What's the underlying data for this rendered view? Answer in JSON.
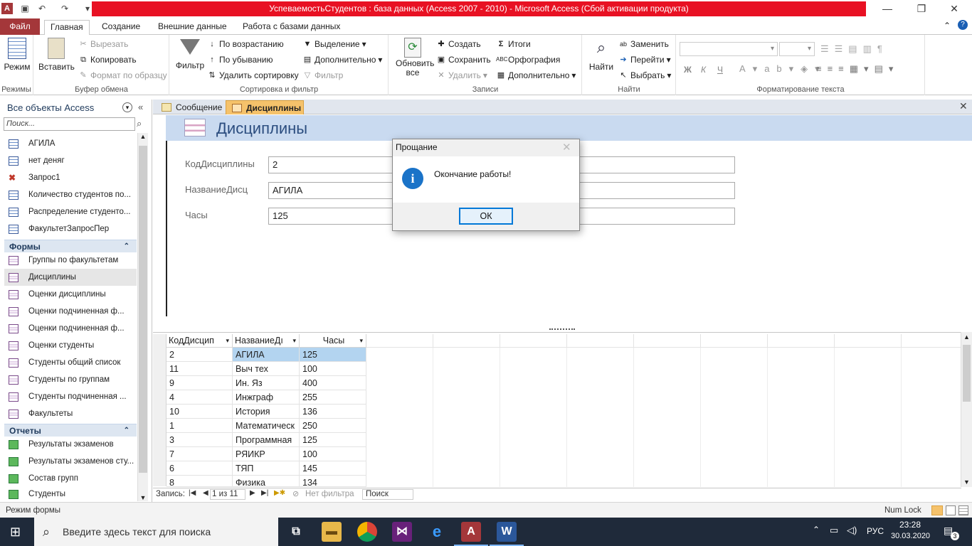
{
  "window": {
    "title": "УспеваемостьСтудентов : база данных (Access 2007 - 2010)  -  Microsoft Access (Сбой активации продукта)",
    "minimize": "—",
    "maximize": "❐",
    "close": "✕"
  },
  "ribbon_tabs": [
    "Файл",
    "Главная",
    "Создание",
    "Внешние данные",
    "Работа с базами данных"
  ],
  "ribbon": {
    "modes": {
      "view_label": "Режим",
      "group": "Режимы"
    },
    "clipboard": {
      "paste": "Вставить",
      "cut": "Вырезать",
      "copy": "Копировать",
      "format_painter": "Формат по образцу",
      "group": "Буфер обмена"
    },
    "sort_filter": {
      "filter": "Фильтр",
      "ascending": "По возрастанию",
      "descending": "По убыванию",
      "remove_sort": "Удалить сортировку",
      "selection": "Выделение",
      "advanced": "Дополнительно",
      "toggle_filter": "Фильтр",
      "group": "Сортировка и фильтр"
    },
    "records": {
      "refresh": "Обновить все",
      "new": "Создать",
      "save": "Сохранить",
      "delete": "Удалить",
      "totals": "Итоги",
      "spelling": "Орфография",
      "more": "Дополнительно",
      "group": "Записи"
    },
    "find": {
      "find": "Найти",
      "replace": "Заменить",
      "goto": "Перейти",
      "select": "Выбрать",
      "group": "Найти"
    },
    "text_format": {
      "bold": "Ж",
      "italic": "К",
      "underline": "Ч",
      "group": "Форматирование текста"
    }
  },
  "nav_pane": {
    "header": "Все объекты Access",
    "search_placeholder": "Поиск...",
    "queries": [
      "АГИЛА",
      "нет деняг",
      "Запрос1",
      "Количество студентов по...",
      "Распределение студенто...",
      "ФакультетЗапросПер"
    ],
    "forms_header": "Формы",
    "forms": [
      "Группы по факультетам",
      "Дисциплины",
      "Оценки дисциплины",
      "Оценки подчиненная ф...",
      "Оценки подчиненная ф...",
      "Оценки студенты",
      "Студенты общий список",
      "Студенты по группам",
      "Студенты подчиненная ...",
      "Факультеты"
    ],
    "reports_header": "Отчеты",
    "reports": [
      "Результаты экзаменов",
      "Результаты экзаменов сту...",
      "Состав групп",
      "Студенты"
    ]
  },
  "doc_tabs": [
    "Сообщение",
    "Дисциплины"
  ],
  "form": {
    "title": "Дисциплины",
    "fields": [
      {
        "label": "КодДисциплины",
        "value": "2"
      },
      {
        "label": "НазваниеДисц",
        "value": "АГИЛА"
      },
      {
        "label": "Часы",
        "value": "125"
      }
    ]
  },
  "datasheet": {
    "columns": [
      "КодДисцип",
      "НазваниеДı",
      "Часы"
    ],
    "rows": [
      [
        "2",
        "АГИЛА",
        "125"
      ],
      [
        "11",
        "Выч тех",
        "100"
      ],
      [
        "9",
        "Ин. Яз",
        "400"
      ],
      [
        "4",
        "Инжграф",
        "255"
      ],
      [
        "10",
        "История",
        "136"
      ],
      [
        "1",
        "Математическ",
        "250"
      ],
      [
        "3",
        "Программная",
        "125"
      ],
      [
        "7",
        "РЯИКР",
        "100"
      ],
      [
        "6",
        "ТЯП",
        "145"
      ],
      [
        "8",
        "Физика",
        "134"
      ]
    ]
  },
  "record_nav": {
    "label": "Запись:",
    "position": "1 из 11",
    "filter": "Нет фильтра",
    "search": "Поиск"
  },
  "status": {
    "mode": "Режим формы",
    "numlock": "Num Lock"
  },
  "dialog": {
    "title": "Прощание",
    "message": "Окончание работы!",
    "ok": "ОК",
    "icon": "i"
  },
  "taskbar": {
    "search_placeholder": "Введите здесь текст для поиска",
    "lang": "РУС",
    "time": "23:28",
    "date": "30.03.2020",
    "notifications": "3"
  }
}
